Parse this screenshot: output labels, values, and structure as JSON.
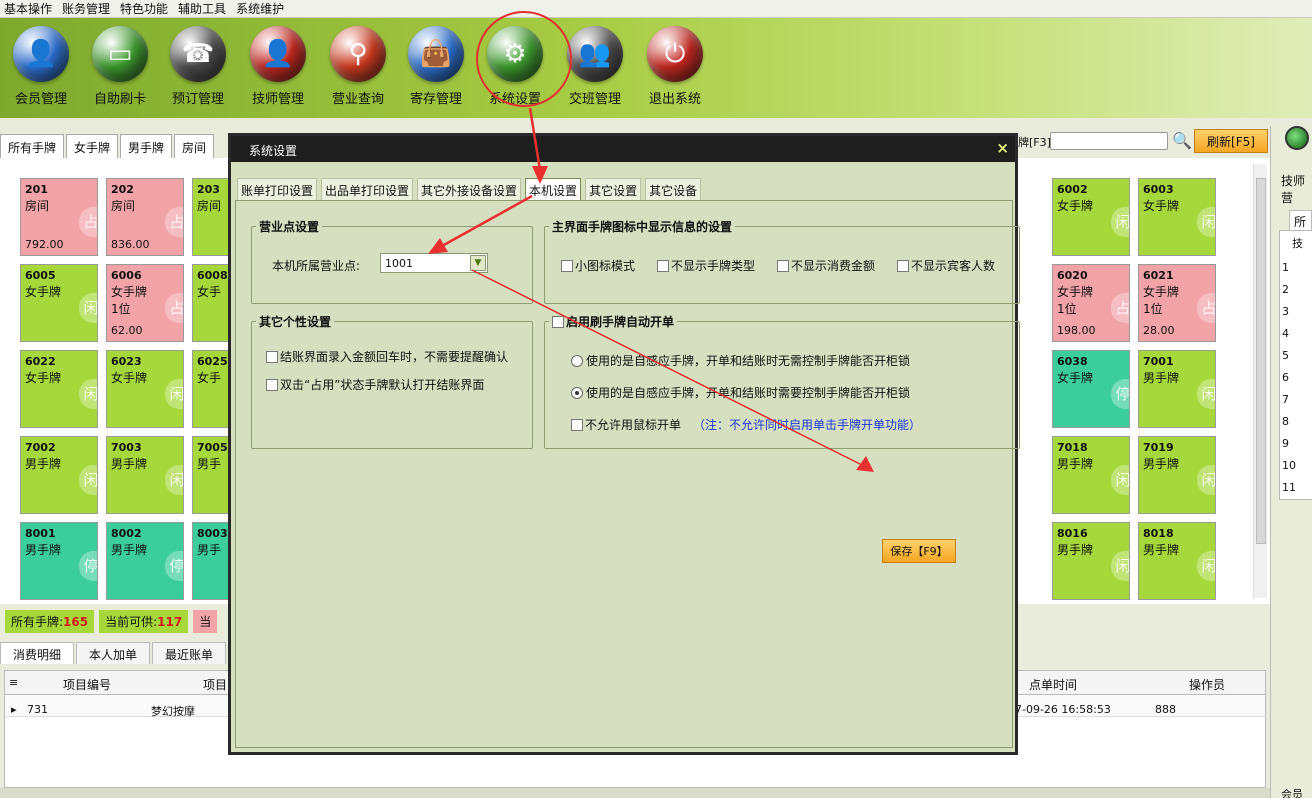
{
  "menu": [
    "基本操作",
    "账务管理",
    "特色功能",
    "辅助工具",
    "系统维护"
  ],
  "toolbar": {
    "buttons": [
      {
        "label": "会员管理",
        "icon": "member-icon",
        "color": "#2a6fd0"
      },
      {
        "label": "自助刷卡",
        "icon": "card-icon",
        "color": "#3c9a2c"
      },
      {
        "label": "预订管理",
        "icon": "phone-icon",
        "color": "#4a4a4a"
      },
      {
        "label": "技师管理",
        "icon": "technician-icon",
        "color": "#c3261f"
      },
      {
        "label": "营业查询",
        "icon": "magnifier-icon",
        "color": "#cc3a1f"
      },
      {
        "label": "寄存管理",
        "icon": "bag-icon",
        "color": "#2a6fd0"
      },
      {
        "label": "系统设置",
        "icon": "gear-icon",
        "color": "#3c9a2c"
      },
      {
        "label": "交班管理",
        "icon": "shift-icon",
        "color": "#4a4a4a"
      },
      {
        "label": "退出系统",
        "icon": "power-icon",
        "color": "#c3261f"
      }
    ]
  },
  "tabs": [
    "所有手牌",
    "女手牌",
    "男手牌",
    "房间"
  ],
  "search": {
    "label_suffix": "牌[F3]",
    "refresh_label": "刷新[F5]"
  },
  "cards_left": [
    {
      "no": "201",
      "type": "房间",
      "extra": "",
      "amount": "792.00",
      "color": "pink",
      "stamp": "占"
    },
    {
      "no": "202",
      "type": "房间",
      "extra": "",
      "amount": "836.00",
      "color": "pink",
      "stamp": "占"
    },
    {
      "no": "203",
      "type": "房间",
      "extra": "",
      "amount": "",
      "color": "green",
      "stamp": ""
    },
    {
      "no": "6005",
      "type": "女手牌",
      "extra": "",
      "amount": "",
      "color": "green",
      "stamp": "闲"
    },
    {
      "no": "6006",
      "type": "女手牌",
      "extra": "1位",
      "amount": "62.00",
      "color": "pink",
      "stamp": "占"
    },
    {
      "no": "6008",
      "type": "女手",
      "extra": "",
      "amount": "",
      "color": "green",
      "stamp": ""
    },
    {
      "no": "6022",
      "type": "女手牌",
      "extra": "",
      "amount": "",
      "color": "green",
      "stamp": "闲"
    },
    {
      "no": "6023",
      "type": "女手牌",
      "extra": "",
      "amount": "",
      "color": "green",
      "stamp": "闲"
    },
    {
      "no": "6025",
      "type": "女手",
      "extra": "",
      "amount": "",
      "color": "green",
      "stamp": ""
    },
    {
      "no": "7002",
      "type": "男手牌",
      "extra": "",
      "amount": "",
      "color": "green",
      "stamp": "闲"
    },
    {
      "no": "7003",
      "type": "男手牌",
      "extra": "",
      "amount": "",
      "color": "green",
      "stamp": "闲"
    },
    {
      "no": "7005",
      "type": "男手",
      "extra": "",
      "amount": "",
      "color": "green",
      "stamp": ""
    },
    {
      "no": "8001",
      "type": "男手牌",
      "extra": "",
      "amount": "",
      "color": "teal",
      "stamp": "停"
    },
    {
      "no": "8002",
      "type": "男手牌",
      "extra": "",
      "amount": "",
      "color": "teal",
      "stamp": "停"
    },
    {
      "no": "8003",
      "type": "男手",
      "extra": "",
      "amount": "",
      "color": "teal",
      "stamp": ""
    }
  ],
  "cards_right": [
    {
      "no": "6002",
      "type": "女手牌",
      "extra": "",
      "amount": "",
      "color": "green",
      "stamp": "闲"
    },
    {
      "no": "6003",
      "type": "女手牌",
      "extra": "",
      "amount": "",
      "color": "green",
      "stamp": "闲"
    },
    {
      "no": "6020",
      "type": "女手牌",
      "extra": "1位",
      "amount": "198.00",
      "color": "pink",
      "stamp": "占"
    },
    {
      "no": "6021",
      "type": "女手牌",
      "extra": "1位",
      "amount": "28.00",
      "color": "pink",
      "stamp": "占"
    },
    {
      "no": "6038",
      "type": "女手牌",
      "extra": "",
      "amount": "",
      "color": "teal",
      "stamp": "停"
    },
    {
      "no": "7001",
      "type": "男手牌",
      "extra": "",
      "amount": "",
      "color": "green",
      "stamp": "闲"
    },
    {
      "no": "7018",
      "type": "男手牌",
      "extra": "",
      "amount": "",
      "color": "green",
      "stamp": "闲"
    },
    {
      "no": "7019",
      "type": "男手牌",
      "extra": "",
      "amount": "",
      "color": "green",
      "stamp": "闲"
    },
    {
      "no": "8016",
      "type": "男手牌",
      "extra": "",
      "amount": "",
      "color": "green",
      "stamp": "闲"
    },
    {
      "no": "8018",
      "type": "男手牌",
      "extra": "",
      "amount": "",
      "color": "green",
      "stamp": "闲"
    }
  ],
  "stats": {
    "all_label": "所有手牌:",
    "all_value": "165",
    "avail_label": "当前可供:",
    "avail_value": "117",
    "third_label": "当"
  },
  "bottom_tabs": [
    "消费明细",
    "本人加单",
    "最近账单"
  ],
  "table": {
    "headers": {
      "code": "项目编号",
      "name": "项目",
      "time": "点单时间",
      "operator": "操作员"
    },
    "row": {
      "code": "731",
      "name": "梦幻按摩",
      "time": "7-09-26 16:58:53",
      "operator": "888"
    }
  },
  "right_panel": {
    "title": "技师营",
    "tab": "所有",
    "col": "技",
    "rows": [
      "1",
      "2",
      "3",
      "4",
      "5",
      "6",
      "7",
      "8",
      "9",
      "10",
      "11"
    ],
    "bottom": "会员"
  },
  "dialog": {
    "title": "系统设置",
    "close": "×",
    "tabs": [
      "账单打印设置",
      "出品单打印设置",
      "其它外接设备设置",
      "本机设置",
      "其它设置",
      "其它设备"
    ],
    "group1": {
      "title": "营业点设置",
      "field_label": "本机所属营业点:",
      "field_value": "1001"
    },
    "group2": {
      "title": "主界面手牌图标中显示信息的设置",
      "options": [
        "小图标模式",
        "不显示手牌类型",
        "不显示消费金额",
        "不显示宾客人数"
      ]
    },
    "group3": {
      "title": "其它个性设置",
      "options": [
        "结账界面录入金额回车时，不需要提醒确认",
        "双击“占用”状态手牌默认打开结账界面"
      ]
    },
    "group4": {
      "title": "启用刷手牌自动开单",
      "radio1": "使用的是自感应手牌，开单和结账时无需控制手牌能否开柜锁",
      "radio2": "使用的是自感应手牌，开单和结账时需要控制手牌能否开柜锁",
      "checkbox": "不允许用鼠标开单",
      "note": "（注：不允许同时启用单击手牌开单功能）"
    },
    "save_label": "保存【F9】"
  }
}
